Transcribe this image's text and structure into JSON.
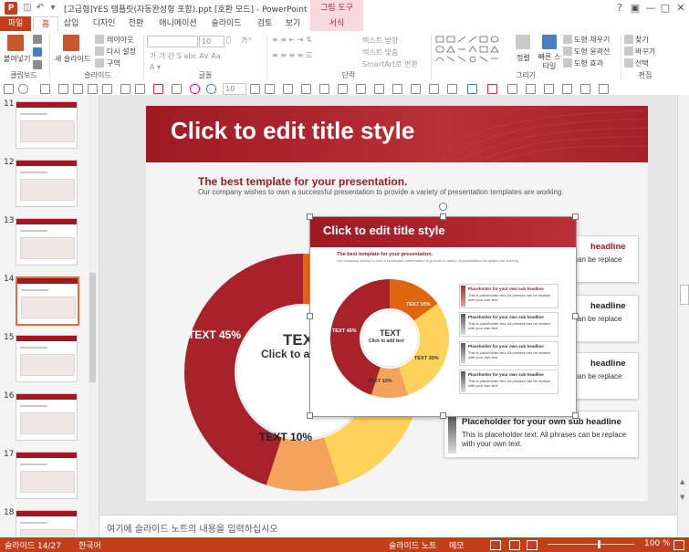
{
  "titlebar": {
    "app_icon": "P",
    "title": "[고급형]YES 템플릿(자동완성형 포함).ppt [호환 모드] - PowerPoint",
    "context_group": "그림 도구",
    "quick_access": [
      "save-icon",
      "undo-icon",
      "redo-icon",
      "customize-icon"
    ],
    "window_buttons": [
      "?",
      "▣",
      "—",
      "□",
      "✕"
    ]
  },
  "tabs": [
    "파일",
    "홈",
    "삽입",
    "디자인",
    "전환",
    "애니메이션",
    "슬라이드 쇼",
    "검토",
    "보기",
    "서식"
  ],
  "ribbon": {
    "clipboard": {
      "paste": "붙여넣기",
      "label": "클립보드"
    },
    "slides": {
      "new_slide": "새 슬라이드",
      "layout": "레이아웃",
      "reset": "다시 설정",
      "section": "구역",
      "label": "슬라이드"
    },
    "font": {
      "size": "10",
      "label": "글꼴"
    },
    "paragraph": {
      "text_direction": "텍스트 방향",
      "align_text": "텍스트 맞춤",
      "smartart": "SmartArt로 변환",
      "label": "단락"
    },
    "drawing": {
      "arrange": "정렬",
      "quick_styles": "빠른 스타일",
      "shape_fill": "도형 채우기",
      "shape_outline": "도형 윤곽선",
      "shape_effects": "도형 효과",
      "label": "그리기"
    },
    "editing": {
      "find": "찾기",
      "replace": "바꾸기",
      "select": "선택",
      "label": "편집"
    }
  },
  "drawbar": {
    "size": "10"
  },
  "thumbnails": [
    {
      "num": "11",
      "selected": false
    },
    {
      "num": "12",
      "selected": false
    },
    {
      "num": "13",
      "selected": false
    },
    {
      "num": "14",
      "selected": true
    },
    {
      "num": "15",
      "selected": false
    },
    {
      "num": "16",
      "selected": false
    },
    {
      "num": "17",
      "selected": false
    },
    {
      "num": "18",
      "selected": false
    }
  ],
  "slide": {
    "title": "Click to edit title style",
    "sub_head": "The best template for your presentation.",
    "sub_body": "Our company wishes to own a successful presentation to provide a variety of presentation templates are working.",
    "donut": {
      "center_title": "TEXT",
      "center_sub": "Click to add text",
      "segments": [
        {
          "label": "TEXT 45%",
          "value": 45,
          "color": "#a8222c"
        },
        {
          "label": "TEXT 10%",
          "value": 10,
          "color": "#f3a35b"
        },
        {
          "label": "TEXT 30%",
          "value": 30,
          "color": "#ffd25a"
        },
        {
          "label": "TEXT 15%",
          "value": 15,
          "color": "#e0650f"
        }
      ]
    },
    "boxes": [
      {
        "head": "headline",
        "body": "can be replace",
        "stripe": "red"
      },
      {
        "head": "headline",
        "body": "can be replace",
        "stripe": "dark"
      },
      {
        "head": "headline",
        "body": "can be replace",
        "stripe": "dark"
      },
      {
        "head": "Placeholder  for your own sub headline",
        "body": "This is placeholder text. All phrases can be replace with your own text.",
        "stripe": "dark"
      }
    ]
  },
  "overlay": {
    "title": "Click to edit title style",
    "sub_head": "The best template for your presentation.",
    "sub_body": "Our company wishes to own a successful presentation to provide a variety of presentation templates are working.",
    "center_title": "TEXT",
    "center_sub": "Click to add text",
    "labels": {
      "a": "TEXT 45%",
      "b": "TEXT 15%",
      "c": "TEXT 30%",
      "d": "TEXT 10%"
    },
    "boxes": [
      {
        "head": "Placeholder  for your own sub headline",
        "body": "This is placeholder text. All phrases can be replace with your own text."
      },
      {
        "head": "Placeholder  for your own sub headline",
        "body": "This is placeholder text. All phrases can be replace with your own text."
      },
      {
        "head": "Placeholder  for your own sub headline",
        "body": "This is placeholder text. All phrases can be replace with your own text."
      },
      {
        "head": "Placeholder  for your own sub headline",
        "body": "This is placeholder text. All phrases can be replace with your own text."
      }
    ]
  },
  "notes_placeholder": "여기에 슬라이드 노트의 내용을 입력하십시오",
  "status": {
    "slide_count": "슬라이드 14/27",
    "language": "한국어",
    "notes": "슬라이드 노트",
    "comments": "메모",
    "zoom": "100 %",
    "zoom_level": 0.58
  },
  "colors": {
    "accent": "#c43e1c",
    "slide_red": "#9b1b22"
  }
}
